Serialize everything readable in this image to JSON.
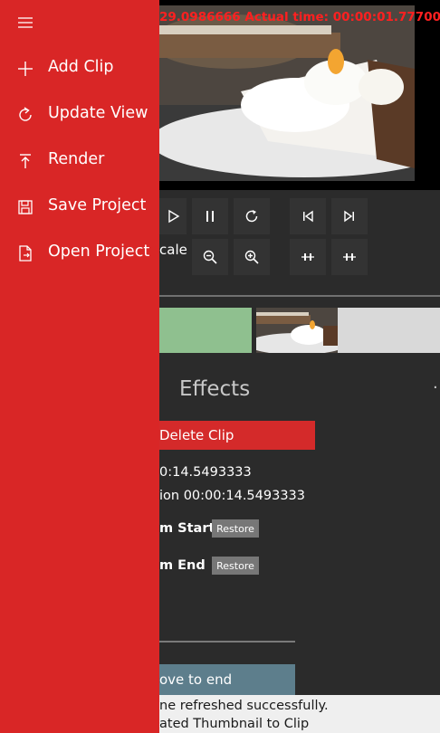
{
  "player": {
    "time_readout": "29.0986666 Actual time: 00:00:01.7770000",
    "scale_label": "cale"
  },
  "drawer": {
    "items": [
      {
        "label": "Add Clip",
        "icon": "plus-icon"
      },
      {
        "label": "Update View",
        "icon": "refresh-icon"
      },
      {
        "label": "Render",
        "icon": "upload-icon"
      },
      {
        "label": "Save Project",
        "icon": "save-icon"
      },
      {
        "label": "Open Project",
        "icon": "open-file-icon"
      }
    ]
  },
  "panel": {
    "effects_tab": "Effects",
    "more": "·",
    "delete_label": "Delete Clip",
    "line1": "0:14.5493333",
    "line2": "ion 00:00:14.5493333",
    "trim_start_label": "m Start",
    "trim_end_label": "m End",
    "restore_label": "Restore",
    "move_label": "ove to end"
  },
  "status": {
    "line1": "ne refreshed successfully.",
    "line2": "ated Thumbnail to Clip"
  },
  "colors": {
    "drawer": "#d92626",
    "time_text": "#ff2020",
    "delete_button": "#d42a2a",
    "clip_green": "#8fc08f"
  }
}
